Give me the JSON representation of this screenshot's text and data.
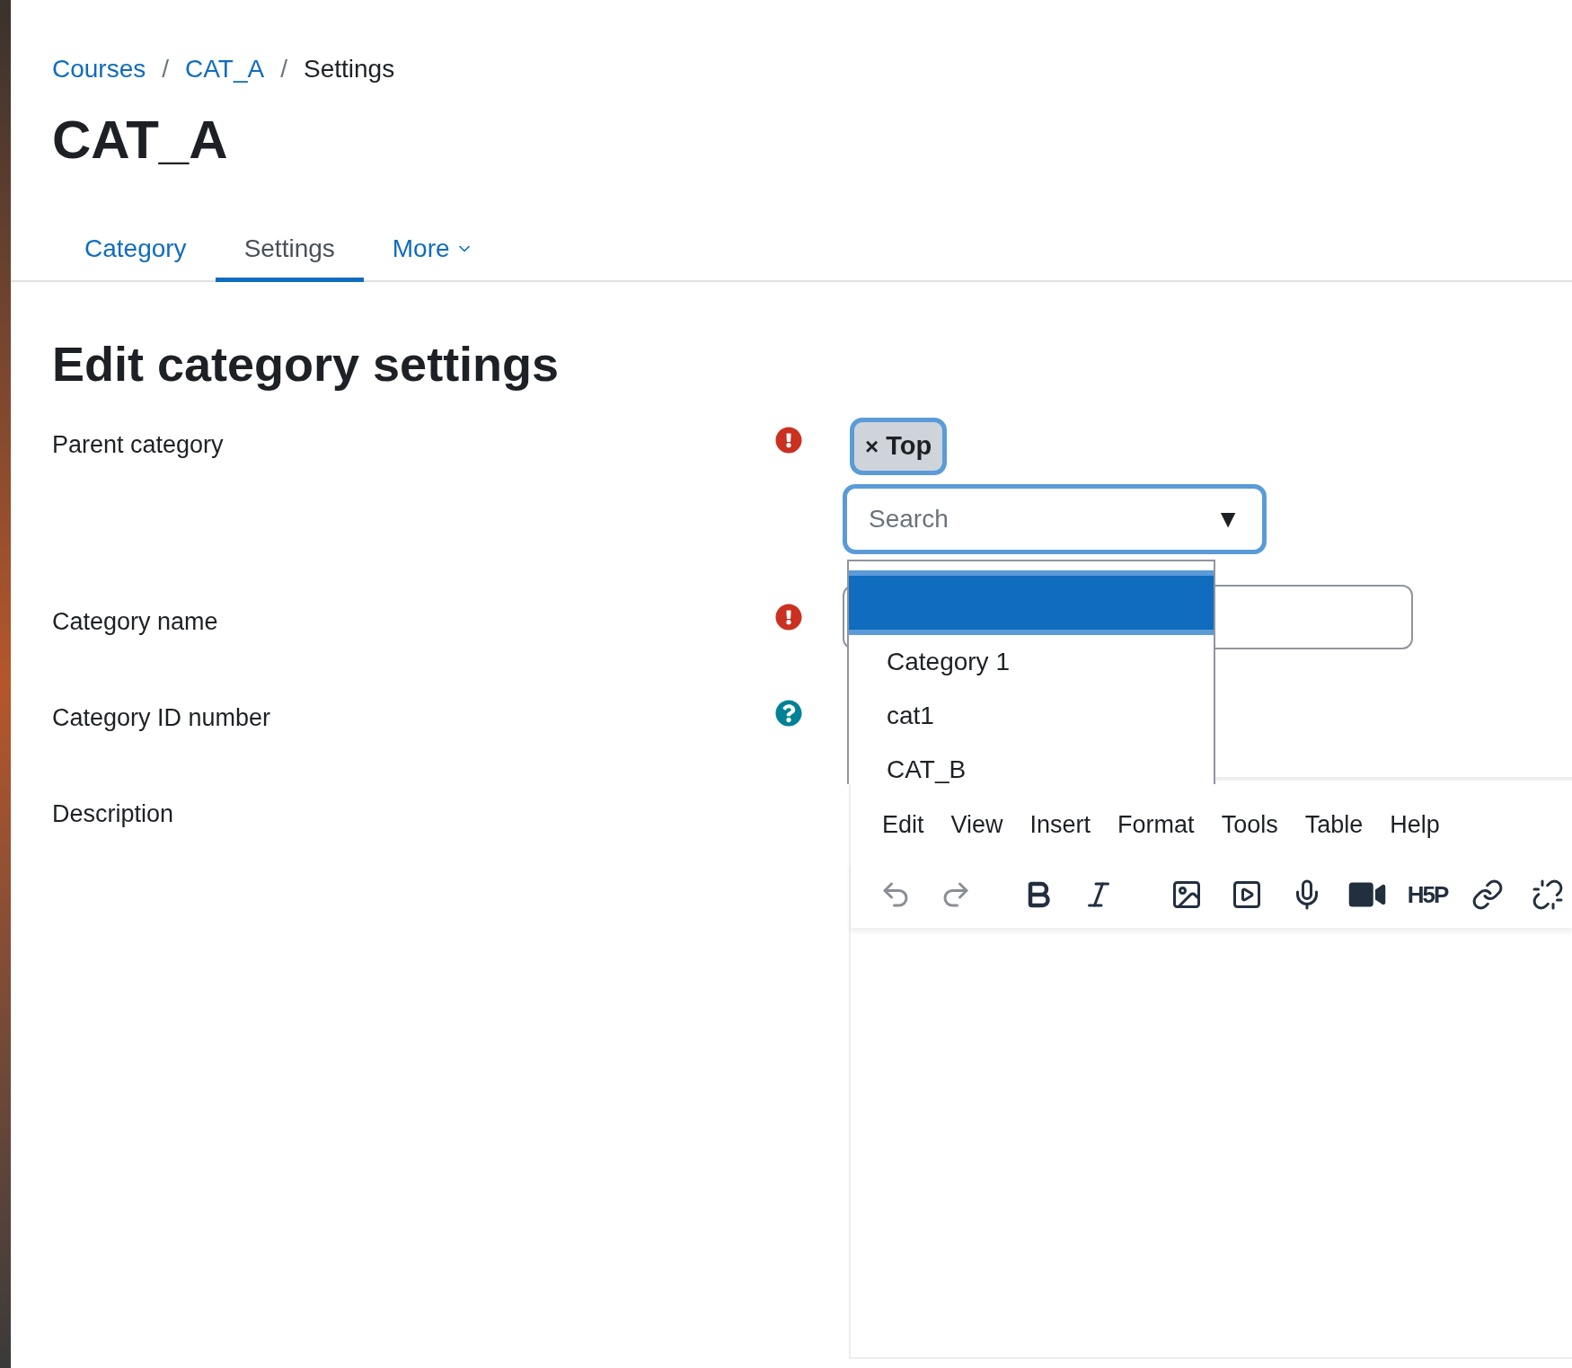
{
  "breadcrumb": {
    "items": [
      {
        "label": "Courses",
        "link": true
      },
      {
        "label": "CAT_A",
        "link": true
      },
      {
        "label": "Settings",
        "link": false
      }
    ],
    "separators": [
      "/",
      "/"
    ]
  },
  "page_title": "CAT_A",
  "tabs": [
    {
      "label": "Category",
      "selected": false,
      "has_menu": false
    },
    {
      "label": "Settings",
      "selected": true,
      "has_menu": false
    },
    {
      "label": "More",
      "selected": false,
      "has_menu": true
    }
  ],
  "heading": "Edit category settings",
  "fields": [
    {
      "label": "Parent category",
      "kind": "required"
    },
    {
      "label": "Category name",
      "kind": "required"
    },
    {
      "label": "Category ID number",
      "kind": "help"
    },
    {
      "label": "Description",
      "kind": "plain"
    }
  ],
  "parent_select": {
    "chip": {
      "remove": "×",
      "label": "Top"
    },
    "search": {
      "placeholder": "Search"
    },
    "arrow": "▼",
    "options": [
      {
        "selected": true
      },
      {
        "label": "Category 1",
        "selected": false
      },
      {
        "label": "cat1",
        "selected": false
      },
      {
        "label": "CAT_B",
        "selected": false
      }
    ]
  },
  "editor": {
    "menu": [
      "Edit",
      "View",
      "Insert",
      "Format",
      "Tools",
      "Table",
      "Help"
    ],
    "toolbar": [
      {
        "kind": "undo",
        "disabled": true
      },
      {
        "kind": "redo",
        "disabled": true
      },
      {
        "kind": "bold",
        "disabled": false
      },
      {
        "kind": "italic",
        "disabled": false
      },
      {
        "kind": "image",
        "disabled": false
      },
      {
        "kind": "media",
        "disabled": false
      },
      {
        "kind": "mic",
        "disabled": false
      },
      {
        "kind": "video",
        "disabled": false
      },
      {
        "kind": "h5p",
        "label": "H5P",
        "disabled": false
      },
      {
        "kind": "link",
        "disabled": false
      },
      {
        "kind": "unlink",
        "disabled": false
      }
    ]
  }
}
